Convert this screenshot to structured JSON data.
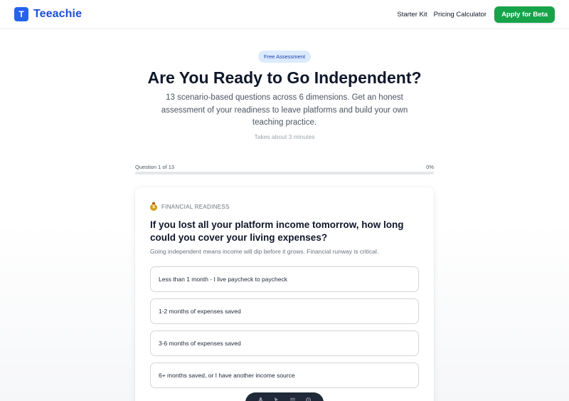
{
  "header": {
    "logo_letter": "T",
    "brand": "Teeachie",
    "nav": {
      "starter_kit": "Starter Kit",
      "pricing_calculator": "Pricing Calculator",
      "apply": "Apply for Beta"
    }
  },
  "hero": {
    "badge": "Free Assessment",
    "title": "Are You Ready to Go Independent?",
    "subtitle": "13 scenario-based questions across 6 dimensions. Get an honest assessment of your readiness to leave platforms and build your own teaching practice.",
    "time_note": "Takes about 3 minutes"
  },
  "progress": {
    "label": "Question 1 of 13",
    "percent_label": "0%",
    "fraction": 0
  },
  "card": {
    "category": "FINANCIAL READINESS",
    "category_icon": "money-bag-icon",
    "question": "If you lost all your platform income tomorrow, how long could you cover your living expenses?",
    "hint": "Going independent means income will dip before it grows. Financial runway is critical.",
    "options": [
      "Less than 1 month - I live paycheck to paycheck",
      "1-2 months of expenses saved",
      "3-6 months of expenses saved",
      "6+ months saved, or I have another income source"
    ]
  },
  "colors": {
    "brand": "#2563eb",
    "cta": "#16a34a",
    "badge_bg": "#dbeafe"
  }
}
